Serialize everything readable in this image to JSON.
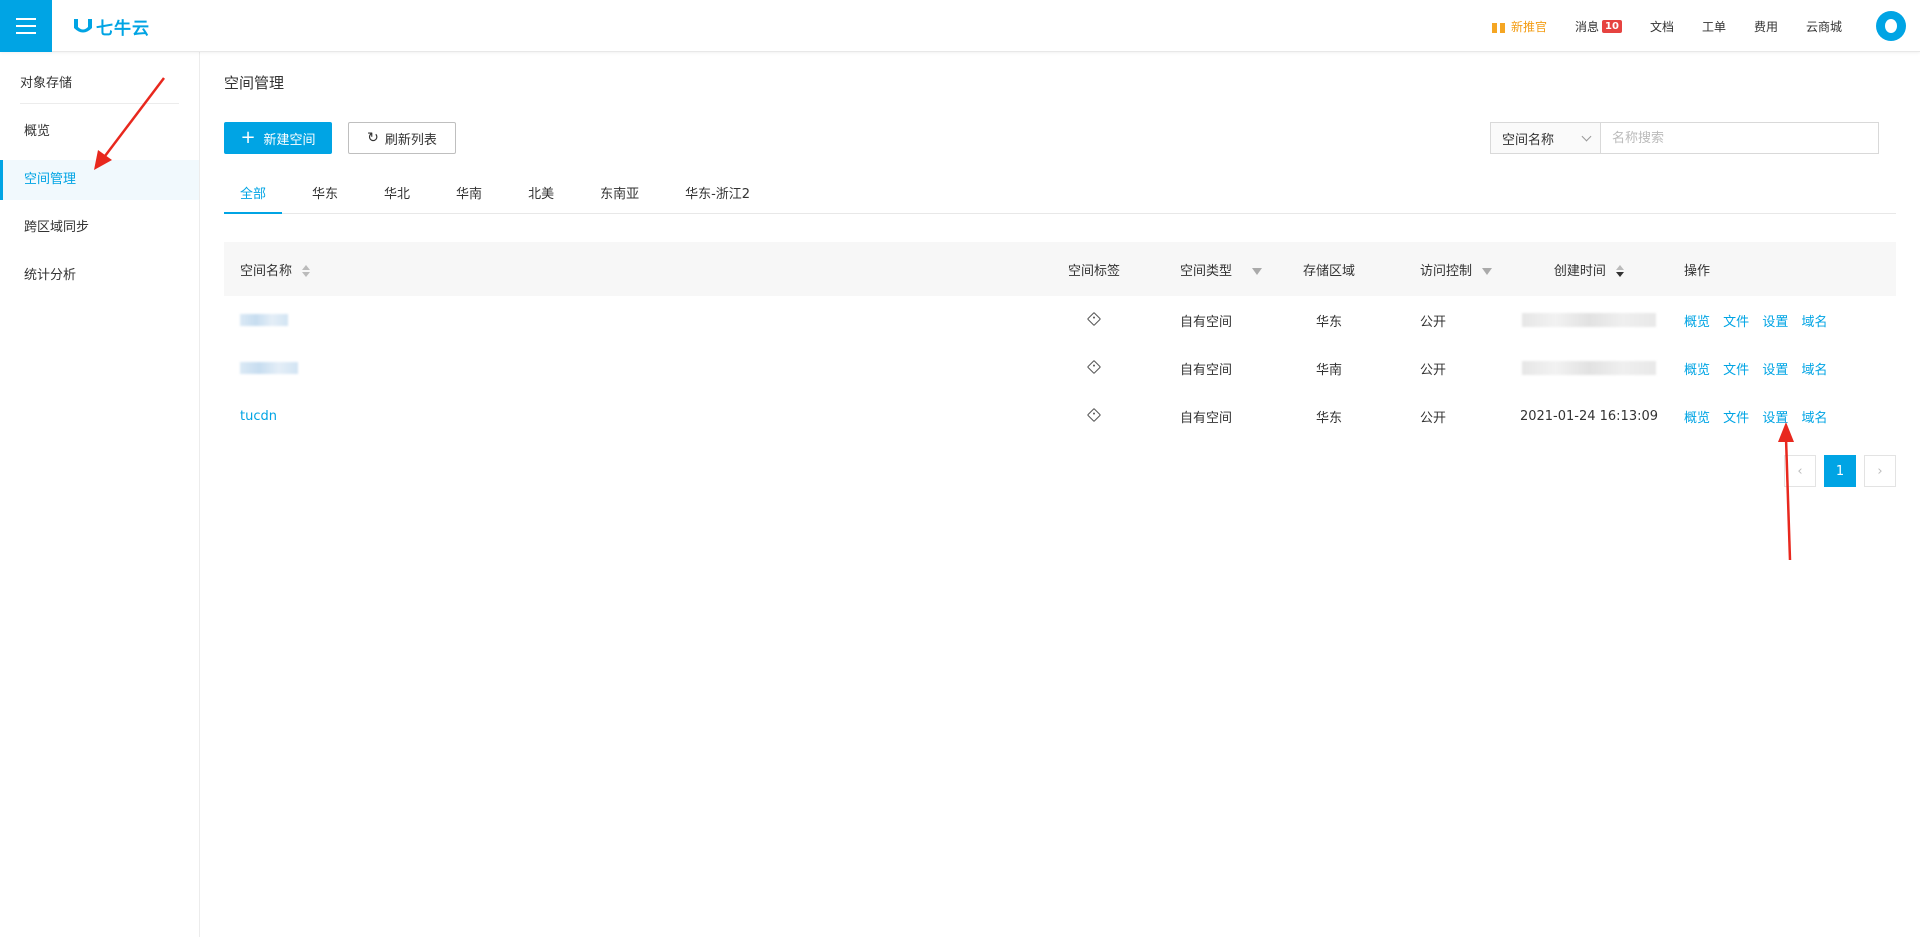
{
  "header": {
    "menu_icon": "hamburger-menu-icon",
    "logo_text": "七牛云",
    "nav": {
      "gift_label": "新推官",
      "messages_label": "消息",
      "messages_count": "10",
      "docs_label": "文档",
      "ticket_label": "工单",
      "billing_label": "费用",
      "market_label": "云商城"
    }
  },
  "sidebar": {
    "title": "对象存储",
    "items": [
      {
        "label": "概览"
      },
      {
        "label": "空间管理"
      },
      {
        "label": "跨区域同步"
      },
      {
        "label": "统计分析"
      }
    ]
  },
  "main": {
    "title": "空间管理",
    "new_button": "新建空间",
    "refresh_button": "刷新列表",
    "search_select": "空间名称",
    "search_placeholder": "名称搜索",
    "tabs": [
      "全部",
      "华东",
      "华北",
      "华南",
      "北美",
      "东南亚",
      "华东-浙江2"
    ],
    "table": {
      "headers": {
        "name": "空间名称",
        "tag": "空间标签",
        "type": "空间类型",
        "region": "存储区域",
        "access": "访问控制",
        "time": "创建时间",
        "ops": "操作"
      },
      "rows": [
        {
          "name": "",
          "type": "自有空间",
          "region": "华东",
          "access": "公开",
          "time": ""
        },
        {
          "name": "",
          "type": "自有空间",
          "region": "华南",
          "access": "公开",
          "time": ""
        },
        {
          "name": "tucdn",
          "type": "自有空间",
          "region": "华东",
          "access": "公开",
          "time": "2021-01-24 16:13:09"
        }
      ],
      "ops": [
        "概览",
        "文件",
        "设置",
        "域名"
      ]
    },
    "pagination": {
      "current": "1"
    }
  },
  "colors": {
    "accent": "#00a4e4",
    "badge": "#e64340",
    "gift": "#f5a623",
    "annotation": "#e8281e"
  }
}
